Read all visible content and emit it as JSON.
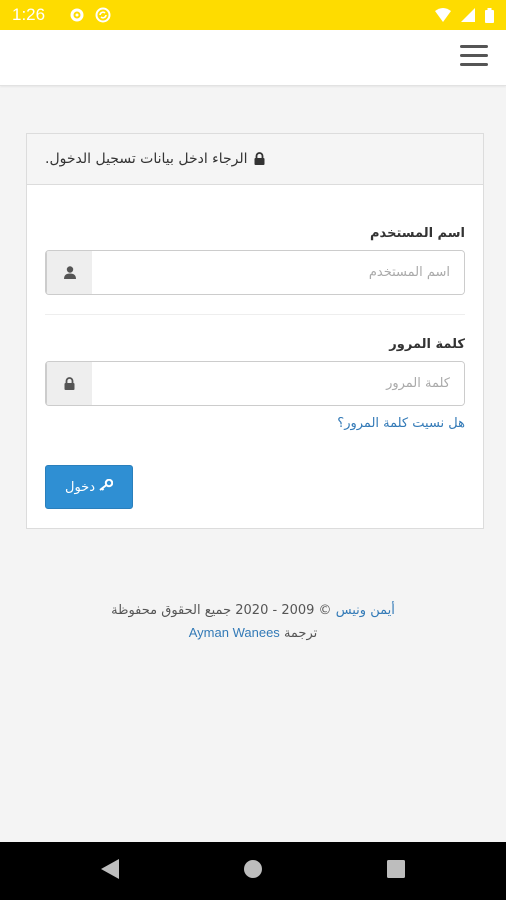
{
  "status_bar": {
    "time": "1:26",
    "left_icons": [
      "gear-icon",
      "sync-icon"
    ],
    "right_icons": [
      "wifi-icon",
      "signal-icon",
      "battery-icon"
    ],
    "background": "#fedc00"
  },
  "app_bar": {
    "menu_icon": "hamburger-menu-icon"
  },
  "login_panel": {
    "heading": "الرجاء ادخل بيانات تسجيل الدخول.",
    "heading_icon": "lock-icon",
    "username": {
      "label": "اسم المستخدم",
      "placeholder": "اسم المستخدم",
      "value": "",
      "icon": "user-icon"
    },
    "password": {
      "label": "كلمة المرور",
      "placeholder": "كلمة المرور",
      "value": "",
      "icon": "lock-icon"
    },
    "forgot_password": "هل نسيت كلمة المرور؟",
    "login_button": {
      "label": "دخول",
      "icon": "key-icon",
      "color": "#2f8fd3"
    }
  },
  "footer": {
    "author_link": "أيمن ونيس",
    "copyright": "© 2009 - 2020 جميع الحقوق محفوظة",
    "translation_label": "ترجمة",
    "translator_link": "Ayman Wanees",
    "link_color": "#337ab7"
  },
  "nav_bar": {
    "buttons": [
      "back-icon",
      "home-icon",
      "recents-icon"
    ]
  }
}
